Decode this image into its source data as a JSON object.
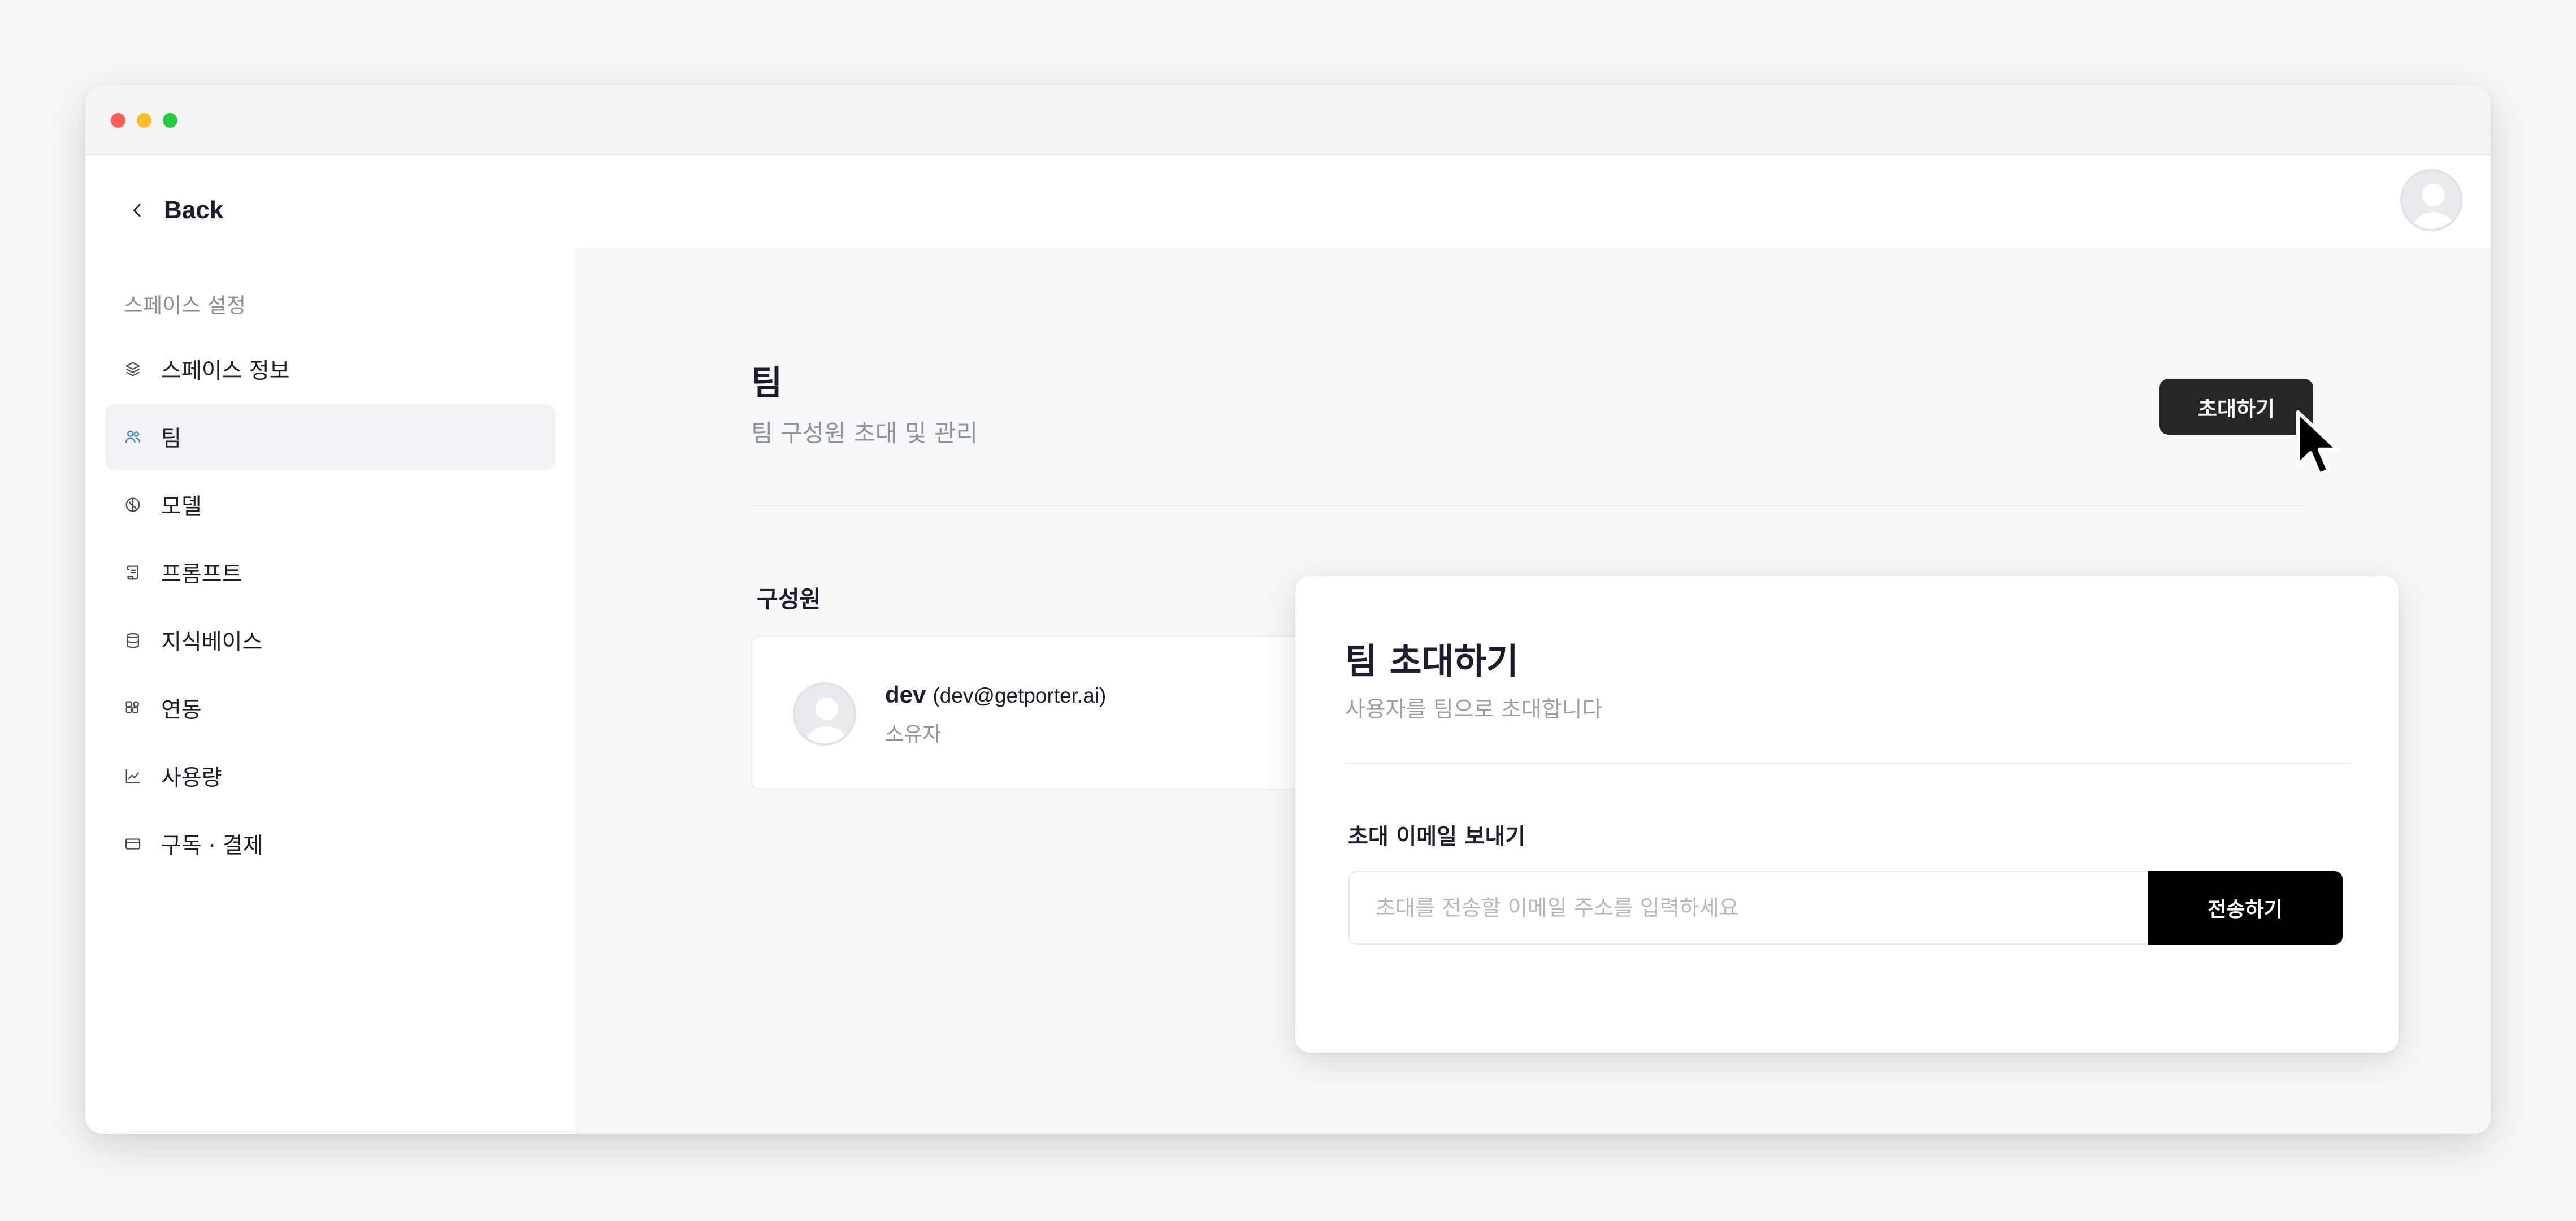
{
  "sidebar": {
    "back_label": "Back",
    "section_label": "스페이스 설정",
    "items": [
      {
        "label": "스페이스 정보",
        "icon": "layers-icon"
      },
      {
        "label": "팀",
        "icon": "users-icon",
        "active": true
      },
      {
        "label": "모델",
        "icon": "model-icon"
      },
      {
        "label": "프롬프트",
        "icon": "scroll-icon"
      },
      {
        "label": "지식베이스",
        "icon": "database-icon"
      },
      {
        "label": "연동",
        "icon": "integration-icon"
      },
      {
        "label": "사용량",
        "icon": "chart-icon"
      },
      {
        "label": "구독 · 결제",
        "icon": "credit-card-icon"
      }
    ]
  },
  "main": {
    "title": "팀",
    "subtitle": "팀 구성원 초대 및 관리",
    "invite_button": "초대하기",
    "members_label": "구성원",
    "members": [
      {
        "name": "dev",
        "email": "(dev@getporter.ai)",
        "role": "소유자"
      }
    ]
  },
  "invite_popover": {
    "title": "팀 초대하기",
    "subtitle": "사용자를 팀으로 초대합니다",
    "email_label": "초대 이메일 보내기",
    "email_placeholder": "초대를 전송할 이메일 주소를 입력하세요",
    "email_value": "",
    "send_button": "전송하기"
  },
  "colors": {
    "accent_dark": "#27272a",
    "send_button": "#000000",
    "active_nav_bg": "#f1f2f5",
    "traffic_red": "#fe5f57",
    "traffic_yellow": "#febc2e",
    "traffic_green": "#28c840"
  }
}
